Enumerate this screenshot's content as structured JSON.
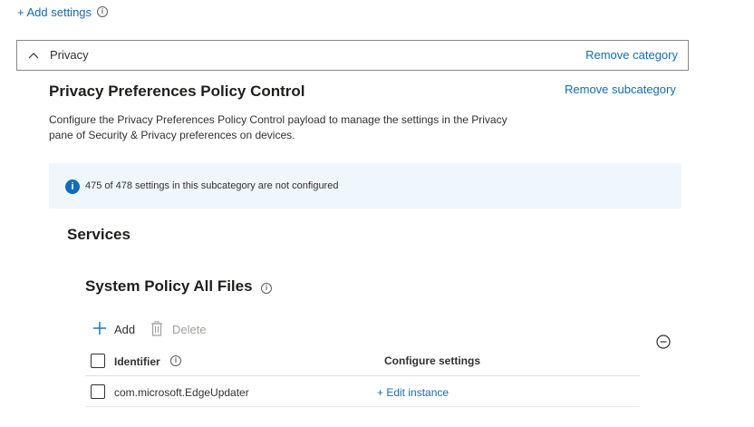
{
  "add_settings": {
    "label": "+ Add settings"
  },
  "category": {
    "name": "Privacy",
    "remove_label": "Remove category"
  },
  "subcategory": {
    "title": "Privacy Preferences Policy Control",
    "remove_label": "Remove subcategory",
    "description_line1": "Configure the Privacy Preferences Policy Control payload to manage the settings in the Privacy",
    "description_line2": "pane of Security & Privacy preferences on devices.",
    "status": "475 of 478 settings in this subcategory are not configured"
  },
  "services": {
    "heading": "Services"
  },
  "setting": {
    "title": "System Policy All Files",
    "toolbar": {
      "add_label": "Add",
      "delete_label": "Delete"
    },
    "table": {
      "col_identifier": "Identifier",
      "col_configure": "Configure settings",
      "rows": [
        {
          "identifier": "com.microsoft.EdgeUpdater",
          "action": "+ Edit instance"
        }
      ]
    }
  },
  "colors": {
    "accent": "#0f6cbd",
    "info_banner_bg": "#eff6fc",
    "info_icon": "#0f6cbd"
  }
}
